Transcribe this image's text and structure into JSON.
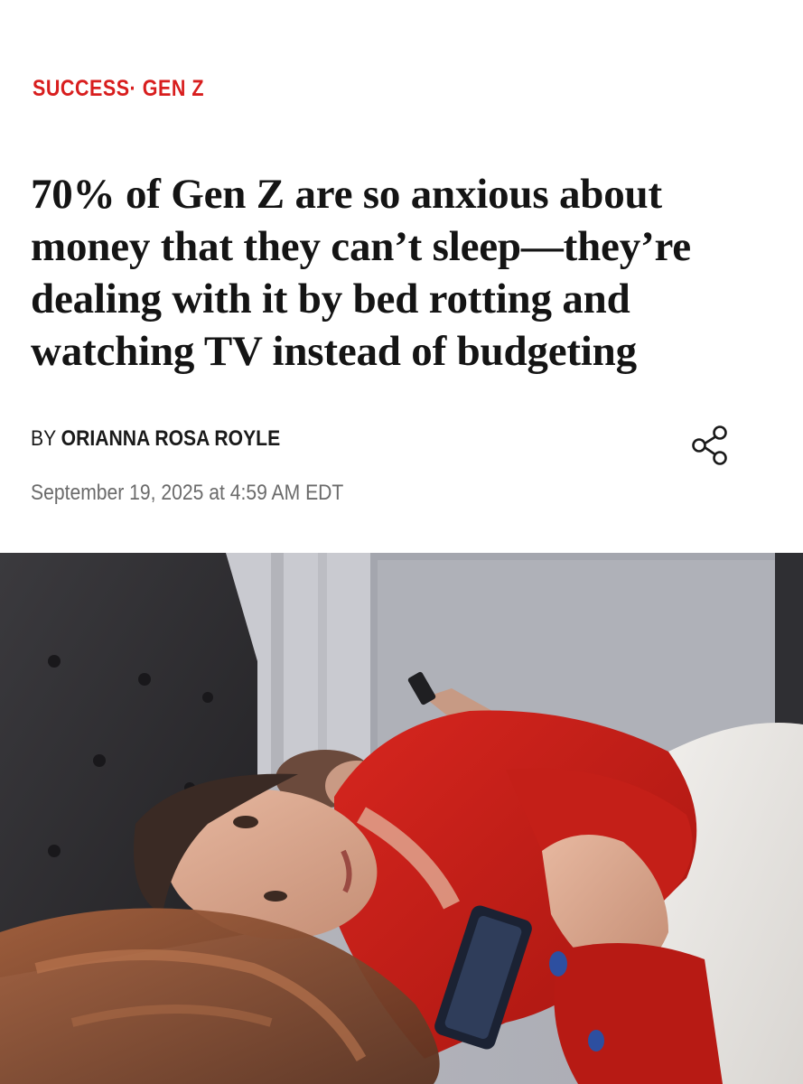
{
  "article": {
    "section": "SUCCESS",
    "separator": "·",
    "topic": "GEN Z",
    "headline": "70% of Gen Z are so anxious about money that they can’t sleep—they’re dealing with it by bed rotting and watching TV instead of budgeting",
    "byline_prefix": "BY",
    "author": "ORIANNA ROSA ROYLE",
    "date": "September 19, 2025 at 4:59 AM EDT"
  },
  "icons": {
    "share": "share-icon"
  },
  "colors": {
    "section_accent": "#d81e1e",
    "headline": "#141414",
    "date": "#6b6b6b",
    "shirt": "#c8211b"
  }
}
